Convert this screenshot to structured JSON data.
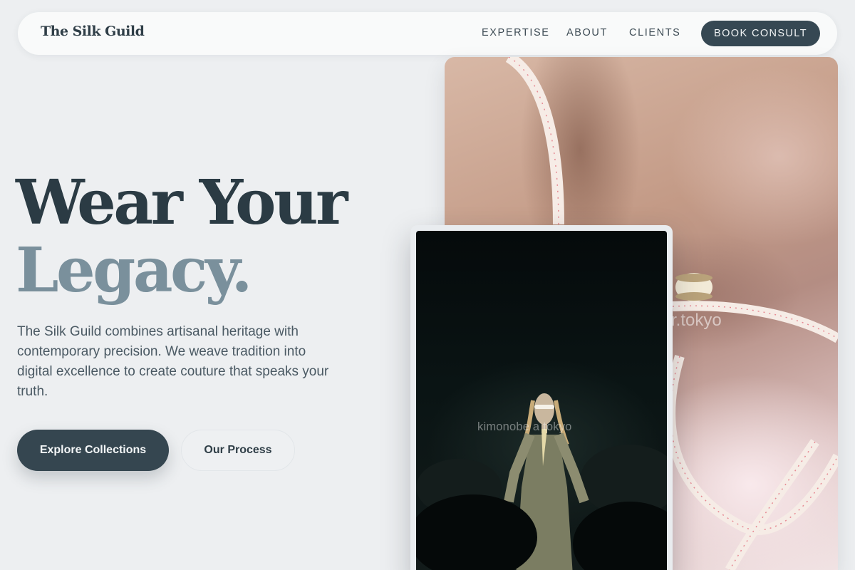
{
  "brand": {
    "logo": "The Silk Guild"
  },
  "nav": {
    "links": [
      "EXPERTISE",
      "ABOUT",
      "CLIENTS"
    ],
    "cta": "BOOK CONSULT"
  },
  "hero": {
    "headline_line1": "Wear Your",
    "headline_line2": "Legacy.",
    "lead": "The Silk Guild combines artisanal heritage with contemporary precision. We weave tradition into digital excellence to create couture that speaks your truth.",
    "primary_button": "Explore Collections",
    "secondary_button": "Our Process"
  },
  "images": {
    "main_watermark": "r.tokyo",
    "inset_watermark": "kimonobe    a tokyo"
  },
  "colors": {
    "background": "#edeff1",
    "accent_dark": "#354650",
    "headline_muted": "#7a909c"
  }
}
